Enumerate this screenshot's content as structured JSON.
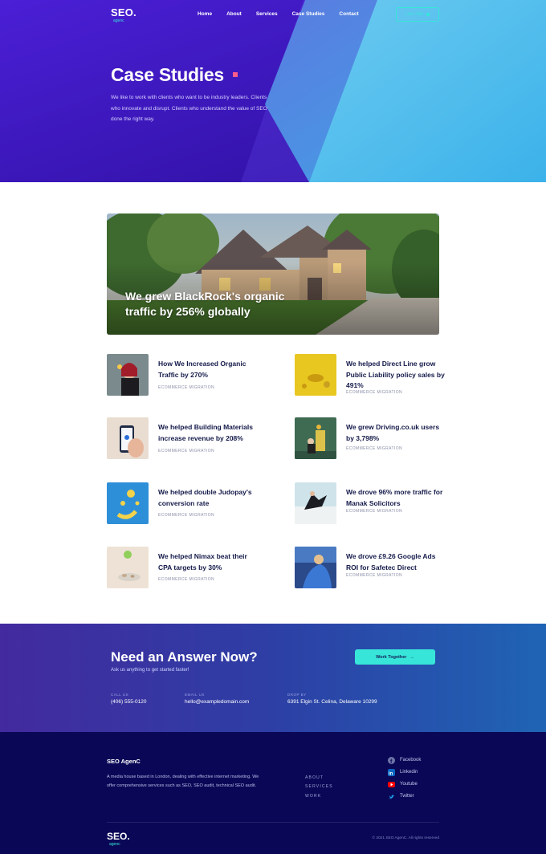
{
  "header": {
    "logo_main": "SEO.",
    "logo_sub": "agenc",
    "nav": [
      "Home",
      "About",
      "Services",
      "Case Studies",
      "Contact"
    ],
    "cta_label": "Let's Talk"
  },
  "hero": {
    "title": "Case Studies",
    "text": "We like to work with clients who want to be industry leaders. Clients who innovate and disrupt. Clients who understand the value of SEO done the right way.",
    "accent_color": "#ff5c8a"
  },
  "feature": {
    "title": "We grew BlackRock's organic traffic by 256% globally"
  },
  "cases": [
    {
      "title": "How We Increased Organic Traffic by 270%",
      "tag": "ECOMMERCE MIGRATION"
    },
    {
      "title": "We helped Direct Line grow Public Liability policy sales by 491%",
      "tag": "ECOMMERCE MIGRATION"
    },
    {
      "title": "We helped Building Materials increase revenue by 208%",
      "tag": "ECOMMERCE MIGRATION"
    },
    {
      "title": "We grew Driving.co.uk users by 3,798%",
      "tag": "ECOMMERCE MIGRATION"
    },
    {
      "title": "We helped double Judopay's conversion rate",
      "tag": "ECOMMERCE MIGRATION"
    },
    {
      "title": "We drove 96% more traffic for Manak Solicitors",
      "tag": "ECOMMERCE MIGRATION"
    },
    {
      "title": "We helped Nimax beat their CPA targets by 30%",
      "tag": "ECOMMERCE MIGRATION"
    },
    {
      "title": "We drove £9.26 Google Ads ROI for Safetec Direct",
      "tag": "ECOMMERCE MIGRATION"
    }
  ],
  "cta": {
    "title": "Need an Answer Now?",
    "subtitle": "Ask us anything to get started faster!",
    "button": "Work Together",
    "call_label": "CALL US",
    "call_value": "(406) 555-0120",
    "email_label": "EMAIL US",
    "email_value": "hello@exampledomain.com",
    "drop_label": "DROP BY",
    "drop_value": "6391 Elgin St. Celina, Delaware 10299"
  },
  "footer": {
    "brand": "SEO AgenC",
    "description": "A media house based in London, dealing with effective internet marketing. We offer comprehensive services such as SEO, SEO audit, technical SEO audit.",
    "links": [
      "ABOUT",
      "SERVICES",
      "WORK"
    ],
    "social": [
      {
        "name": "Facebook",
        "icon": "facebook-icon",
        "color": "#6f74a8"
      },
      {
        "name": "Linkedin",
        "icon": "linkedin-icon",
        "color": "#0a66c2"
      },
      {
        "name": "Youtube",
        "icon": "youtube-icon",
        "color": "#ff0000"
      },
      {
        "name": "Twitter",
        "icon": "twitter-icon",
        "color": "#1da1f2"
      }
    ],
    "logo_main": "SEO.",
    "logo_sub": "agenc",
    "copyright": "© 2021 SEO AgenC. All rights reserved"
  },
  "colors": {
    "accent_teal": "#37e6d8",
    "hero_purple": "#3a13b8",
    "footer_navy": "#0a0856"
  }
}
